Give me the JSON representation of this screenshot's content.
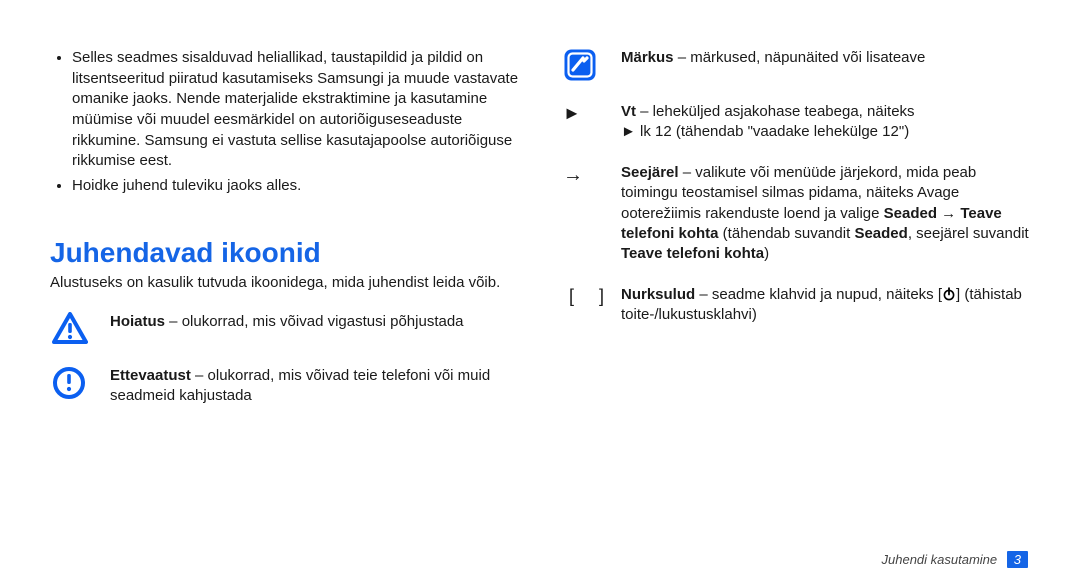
{
  "left": {
    "bullets": [
      "Selles seadmes sisalduvad heliallikad, taustapildid ja pildid on litsentseeritud piiratud kasutamiseks Samsungi ja muude vastavate omanike jaoks. Nende materjalide ekstraktimine ja kasutamine müümise või muudel eesmärkidel on autoriõiguseseaduste rikkumine. Samsung ei vastuta sellise kasutajapoolse autoriõiguse rikkumise eest.",
      "Hoidke juhend tuleviku jaoks alles."
    ],
    "heading": "Juhendavad ikoonid",
    "intro": "Alustuseks on kasulik tutvuda ikoonidega, mida juhendist leida võib.",
    "warning_bold": "Hoiatus",
    "warning_rest": " – olukorrad, mis võivad vigastusi põhjustada",
    "caution_bold": "Ettevaatust",
    "caution_rest": " – olukorrad, mis võivad teie telefoni või muid seadmeid kahjustada"
  },
  "right": {
    "note_bold": "Märkus",
    "note_rest": " – märkused, näpunäited või lisateave",
    "vt_sym": "►",
    "vt_bold": "Vt",
    "vt_rest_line1": " – leheküljed asjakohase teabega, näiteks",
    "vt_line2_prefix": "► lk 12 (tähendab \"vaadake lehekülge 12\")",
    "arrow_sym": "→",
    "seq_bold": "Seejärel",
    "seq_text1": " – valikute või menüüde järjekord, mida peab toimingu teostamisel silmas pidama, näiteks Avage ooterežiimis rakenduste loend ja valige ",
    "seq_boldpath": "Seaded → Teave telefoni kohta",
    "seq_text2": " (tähendab suvandit ",
    "seq_bold2": "Seaded",
    "seq_text3": ", seejärel suvandit ",
    "seq_bold3": "Teave telefoni kohta",
    "seq_text4": ")",
    "brackets_sym": "[    ]",
    "brackets_bold": "Nurksulud",
    "brackets_rest": " – seadme klahvid ja nupud, näiteks [",
    "brackets_tail": "] (tähistab toite-/lukustusklahvi)"
  },
  "footer": {
    "text": "Juhendi kasutamine",
    "page": "3"
  }
}
